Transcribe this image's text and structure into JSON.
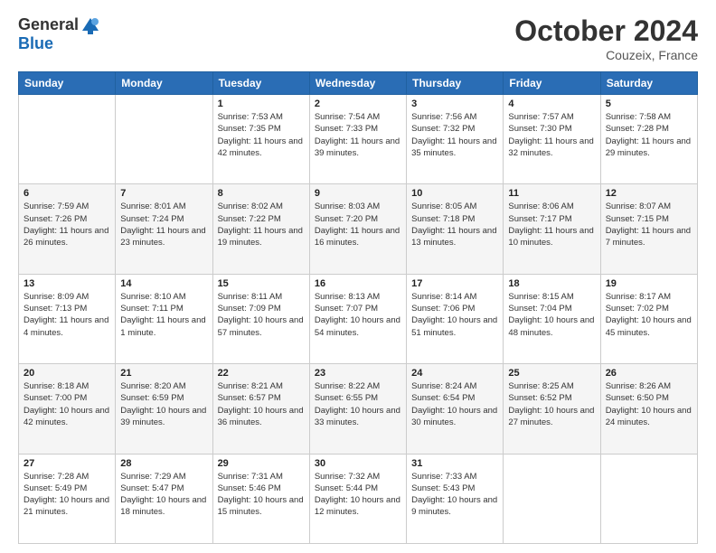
{
  "header": {
    "logo": {
      "general": "General",
      "blue": "Blue"
    },
    "title": "October 2024",
    "location": "Couzeix, France"
  },
  "calendar": {
    "days_of_week": [
      "Sunday",
      "Monday",
      "Tuesday",
      "Wednesday",
      "Thursday",
      "Friday",
      "Saturday"
    ],
    "weeks": [
      [
        {
          "day": "",
          "sunrise": "",
          "sunset": "",
          "daylight": ""
        },
        {
          "day": "",
          "sunrise": "",
          "sunset": "",
          "daylight": ""
        },
        {
          "day": "1",
          "sunrise": "Sunrise: 7:53 AM",
          "sunset": "Sunset: 7:35 PM",
          "daylight": "Daylight: 11 hours and 42 minutes."
        },
        {
          "day": "2",
          "sunrise": "Sunrise: 7:54 AM",
          "sunset": "Sunset: 7:33 PM",
          "daylight": "Daylight: 11 hours and 39 minutes."
        },
        {
          "day": "3",
          "sunrise": "Sunrise: 7:56 AM",
          "sunset": "Sunset: 7:32 PM",
          "daylight": "Daylight: 11 hours and 35 minutes."
        },
        {
          "day": "4",
          "sunrise": "Sunrise: 7:57 AM",
          "sunset": "Sunset: 7:30 PM",
          "daylight": "Daylight: 11 hours and 32 minutes."
        },
        {
          "day": "5",
          "sunrise": "Sunrise: 7:58 AM",
          "sunset": "Sunset: 7:28 PM",
          "daylight": "Daylight: 11 hours and 29 minutes."
        }
      ],
      [
        {
          "day": "6",
          "sunrise": "Sunrise: 7:59 AM",
          "sunset": "Sunset: 7:26 PM",
          "daylight": "Daylight: 11 hours and 26 minutes."
        },
        {
          "day": "7",
          "sunrise": "Sunrise: 8:01 AM",
          "sunset": "Sunset: 7:24 PM",
          "daylight": "Daylight: 11 hours and 23 minutes."
        },
        {
          "day": "8",
          "sunrise": "Sunrise: 8:02 AM",
          "sunset": "Sunset: 7:22 PM",
          "daylight": "Daylight: 11 hours and 19 minutes."
        },
        {
          "day": "9",
          "sunrise": "Sunrise: 8:03 AM",
          "sunset": "Sunset: 7:20 PM",
          "daylight": "Daylight: 11 hours and 16 minutes."
        },
        {
          "day": "10",
          "sunrise": "Sunrise: 8:05 AM",
          "sunset": "Sunset: 7:18 PM",
          "daylight": "Daylight: 11 hours and 13 minutes."
        },
        {
          "day": "11",
          "sunrise": "Sunrise: 8:06 AM",
          "sunset": "Sunset: 7:17 PM",
          "daylight": "Daylight: 11 hours and 10 minutes."
        },
        {
          "day": "12",
          "sunrise": "Sunrise: 8:07 AM",
          "sunset": "Sunset: 7:15 PM",
          "daylight": "Daylight: 11 hours and 7 minutes."
        }
      ],
      [
        {
          "day": "13",
          "sunrise": "Sunrise: 8:09 AM",
          "sunset": "Sunset: 7:13 PM",
          "daylight": "Daylight: 11 hours and 4 minutes."
        },
        {
          "day": "14",
          "sunrise": "Sunrise: 8:10 AM",
          "sunset": "Sunset: 7:11 PM",
          "daylight": "Daylight: 11 hours and 1 minute."
        },
        {
          "day": "15",
          "sunrise": "Sunrise: 8:11 AM",
          "sunset": "Sunset: 7:09 PM",
          "daylight": "Daylight: 10 hours and 57 minutes."
        },
        {
          "day": "16",
          "sunrise": "Sunrise: 8:13 AM",
          "sunset": "Sunset: 7:07 PM",
          "daylight": "Daylight: 10 hours and 54 minutes."
        },
        {
          "day": "17",
          "sunrise": "Sunrise: 8:14 AM",
          "sunset": "Sunset: 7:06 PM",
          "daylight": "Daylight: 10 hours and 51 minutes."
        },
        {
          "day": "18",
          "sunrise": "Sunrise: 8:15 AM",
          "sunset": "Sunset: 7:04 PM",
          "daylight": "Daylight: 10 hours and 48 minutes."
        },
        {
          "day": "19",
          "sunrise": "Sunrise: 8:17 AM",
          "sunset": "Sunset: 7:02 PM",
          "daylight": "Daylight: 10 hours and 45 minutes."
        }
      ],
      [
        {
          "day": "20",
          "sunrise": "Sunrise: 8:18 AM",
          "sunset": "Sunset: 7:00 PM",
          "daylight": "Daylight: 10 hours and 42 minutes."
        },
        {
          "day": "21",
          "sunrise": "Sunrise: 8:20 AM",
          "sunset": "Sunset: 6:59 PM",
          "daylight": "Daylight: 10 hours and 39 minutes."
        },
        {
          "day": "22",
          "sunrise": "Sunrise: 8:21 AM",
          "sunset": "Sunset: 6:57 PM",
          "daylight": "Daylight: 10 hours and 36 minutes."
        },
        {
          "day": "23",
          "sunrise": "Sunrise: 8:22 AM",
          "sunset": "Sunset: 6:55 PM",
          "daylight": "Daylight: 10 hours and 33 minutes."
        },
        {
          "day": "24",
          "sunrise": "Sunrise: 8:24 AM",
          "sunset": "Sunset: 6:54 PM",
          "daylight": "Daylight: 10 hours and 30 minutes."
        },
        {
          "day": "25",
          "sunrise": "Sunrise: 8:25 AM",
          "sunset": "Sunset: 6:52 PM",
          "daylight": "Daylight: 10 hours and 27 minutes."
        },
        {
          "day": "26",
          "sunrise": "Sunrise: 8:26 AM",
          "sunset": "Sunset: 6:50 PM",
          "daylight": "Daylight: 10 hours and 24 minutes."
        }
      ],
      [
        {
          "day": "27",
          "sunrise": "Sunrise: 7:28 AM",
          "sunset": "Sunset: 5:49 PM",
          "daylight": "Daylight: 10 hours and 21 minutes."
        },
        {
          "day": "28",
          "sunrise": "Sunrise: 7:29 AM",
          "sunset": "Sunset: 5:47 PM",
          "daylight": "Daylight: 10 hours and 18 minutes."
        },
        {
          "day": "29",
          "sunrise": "Sunrise: 7:31 AM",
          "sunset": "Sunset: 5:46 PM",
          "daylight": "Daylight: 10 hours and 15 minutes."
        },
        {
          "day": "30",
          "sunrise": "Sunrise: 7:32 AM",
          "sunset": "Sunset: 5:44 PM",
          "daylight": "Daylight: 10 hours and 12 minutes."
        },
        {
          "day": "31",
          "sunrise": "Sunrise: 7:33 AM",
          "sunset": "Sunset: 5:43 PM",
          "daylight": "Daylight: 10 hours and 9 minutes."
        },
        {
          "day": "",
          "sunrise": "",
          "sunset": "",
          "daylight": ""
        },
        {
          "day": "",
          "sunrise": "",
          "sunset": "",
          "daylight": ""
        }
      ]
    ]
  }
}
